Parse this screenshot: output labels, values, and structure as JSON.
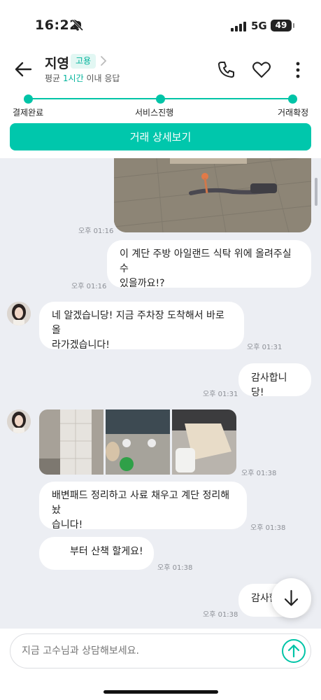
{
  "status_bar": {
    "time": "16:22",
    "network": "5G",
    "battery": "49"
  },
  "header": {
    "name": "지영",
    "badge": "고용",
    "response_prefix": "평균 ",
    "response_highlight": "1시간",
    "response_suffix": " 이내 응답"
  },
  "progress": {
    "steps": [
      "결제완료",
      "서비스진행",
      "거래확정"
    ],
    "completed_steps": 3
  },
  "detail_button": "거래 상세보기",
  "messages": [
    {
      "sender": "me",
      "type": "image",
      "time": "오후 01:16"
    },
    {
      "sender": "me",
      "type": "text",
      "text_lines": [
        "이 계단 주방 아일랜드 식탁 위에 올려주실 수",
        "있을까요!?"
      ],
      "time": "오후 01:16"
    },
    {
      "sender": "expert",
      "type": "text",
      "text_lines": [
        "네 알겠습니당! 지금 주차장 도착해서 바로 올",
        "라가겠습니다!"
      ],
      "time": "오후 01:31"
    },
    {
      "sender": "me",
      "type": "text",
      "text": "감사합니당!",
      "time": "오후 01:31"
    },
    {
      "sender": "expert",
      "type": "images",
      "count": 3,
      "time": "오후 01:38"
    },
    {
      "sender": "expert",
      "type": "text",
      "text_lines": [
        "배변패드 정리하고 사료 채우고 계단 정리해놨",
        "습니다!"
      ],
      "time": "오후 01:38"
    },
    {
      "sender": "expert",
      "type": "text",
      "text": "부터 산책 할게요!",
      "time": "오후 01:38"
    },
    {
      "sender": "me",
      "type": "text",
      "text": "감사합",
      "time": "오후 01:38"
    }
  ],
  "input": {
    "placeholder": "지금 고수님과 상담해보세요."
  },
  "colors": {
    "accent": "#00c4a7",
    "chat_background": "#eceef3",
    "bubble": "#ffffff"
  },
  "icons": [
    "bell-off-icon",
    "signal-icon",
    "back-arrow-icon",
    "chevron-right-icon",
    "phone-icon",
    "heart-icon",
    "more-vertical-icon",
    "scroll-down-icon",
    "send-icon"
  ]
}
